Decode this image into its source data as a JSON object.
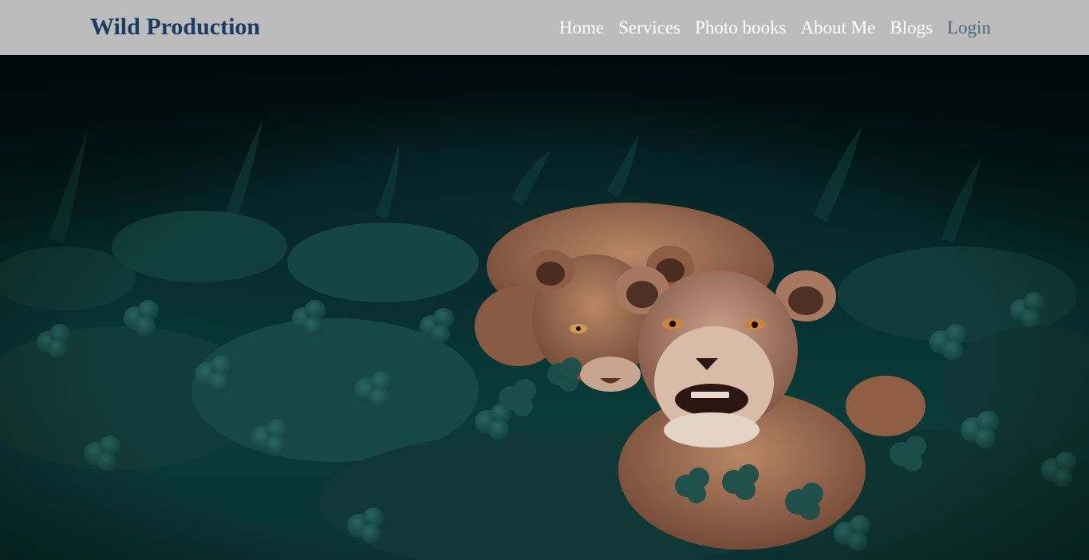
{
  "navbar": {
    "brand": "Wild Production",
    "links": [
      {
        "label": "Home"
      },
      {
        "label": "Services"
      },
      {
        "label": "Photo books"
      },
      {
        "label": "About Me"
      },
      {
        "label": "Blogs"
      },
      {
        "label": "Login"
      }
    ]
  },
  "hero": {
    "image_subject": "two-lionesses-in-clover",
    "colors": {
      "nav_bg": "#bcbcbc",
      "brand": "#1c3a63",
      "link": "#ffffff",
      "login": "#4a6b76"
    }
  }
}
